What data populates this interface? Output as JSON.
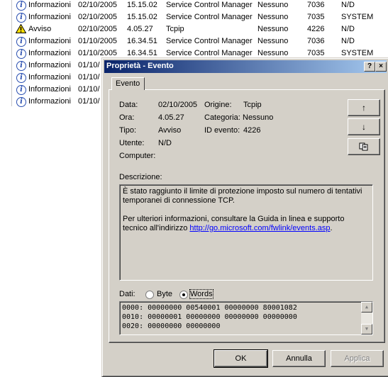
{
  "events": [
    {
      "type": "Informazioni",
      "icon": "info",
      "date": "02/10/2005",
      "time": "15.15.02",
      "source": "Service Control Manager",
      "category": "Nessuno",
      "id": "7036",
      "user": "N/D"
    },
    {
      "type": "Informazioni",
      "icon": "info",
      "date": "02/10/2005",
      "time": "15.15.02",
      "source": "Service Control Manager",
      "category": "Nessuno",
      "id": "7035",
      "user": "SYSTEM"
    },
    {
      "type": "Avviso",
      "icon": "warning",
      "date": "02/10/2005",
      "time": "4.05.27",
      "source": "Tcpip",
      "category": "Nessuno",
      "id": "4226",
      "user": "N/D"
    },
    {
      "type": "Informazioni",
      "icon": "info",
      "date": "01/10/2005",
      "time": "16.34.51",
      "source": "Service Control Manager",
      "category": "Nessuno",
      "id": "7036",
      "user": "N/D"
    },
    {
      "type": "Informazioni",
      "icon": "info",
      "date": "01/10/2005",
      "time": "16.34.51",
      "source": "Service Control Manager",
      "category": "Nessuno",
      "id": "7035",
      "user": "SYSTEM"
    },
    {
      "type": "Informazioni",
      "icon": "info",
      "date": "01/10/",
      "time": "",
      "source": "",
      "category": "",
      "id": "",
      "user": ""
    },
    {
      "type": "Informazioni",
      "icon": "info",
      "date": "01/10/",
      "time": "",
      "source": "",
      "category": "",
      "id": "",
      "user": ""
    },
    {
      "type": "Informazioni",
      "icon": "info",
      "date": "01/10/",
      "time": "",
      "source": "",
      "category": "",
      "id": "",
      "user": ""
    },
    {
      "type": "Informazioni",
      "icon": "info",
      "date": "01/10/",
      "time": "",
      "source": "",
      "category": "",
      "id": "",
      "user": ""
    }
  ],
  "dialog": {
    "title": "Proprietà - Evento",
    "help_btn": "?",
    "close_btn": "×",
    "tab": "Evento",
    "fields": {
      "data_label": "Data:",
      "data_value": "02/10/2005",
      "ora_label": "Ora:",
      "ora_value": "4.05.27",
      "tipo_label": "Tipo:",
      "tipo_value": "Avviso",
      "utente_label": "Utente:",
      "utente_value": "N/D",
      "computer_label": "Computer:",
      "origine_label": "Origine:",
      "origine_value": "Tcpip",
      "categoria_label": "Categoria:",
      "categoria_value": "Nessuno",
      "idevento_label": "ID evento:",
      "idevento_value": "4226"
    },
    "side_buttons": {
      "up": "↑",
      "down": "↓",
      "copy": "copy"
    },
    "description_label": "Descrizione:",
    "description": {
      "para1": "È stato raggiunto il limite di protezione imposto sul numero di tentativi temporanei di connessione TCP.",
      "para2_prefix": "Per ulteriori informazioni, consultare la Guida in linea e supporto tecnico all'indirizzo ",
      "link": "http://go.microsoft.com/fwlink/events.asp",
      "para2_suffix": "."
    },
    "data_label": "Dati:",
    "radio_byte": "Byte",
    "radio_words": "Words",
    "selected_radio": "Words",
    "hex_lines": [
      "0000: 00000000 00540001 00000000 80001082",
      "0010: 00000001 00000000 00000000 00000000",
      "0020: 00000000 00000000"
    ],
    "buttons": {
      "ok": "OK",
      "cancel": "Annulla",
      "apply": "Applica"
    }
  }
}
